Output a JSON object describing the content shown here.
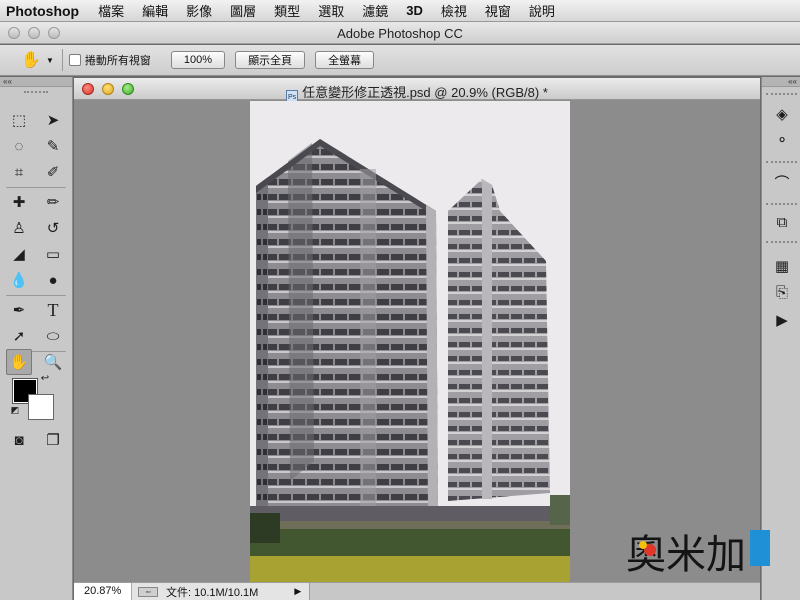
{
  "menu": {
    "app": "Photoshop",
    "items": [
      "檔案",
      "編輯",
      "影像",
      "圖層",
      "類型",
      "選取",
      "濾鏡",
      "3D",
      "檢視",
      "視窗",
      "說明"
    ]
  },
  "window": {
    "title": "Adobe Photoshop CC"
  },
  "options": {
    "scroll_all_label": "捲動所有視窗",
    "zoom_100": "100%",
    "fit_screen": "顯示全頁",
    "fill_screen": "全螢幕"
  },
  "document": {
    "title": "任意變形修正透視.psd @ 20.9% (RGB/8) *",
    "icon_text": "Ps"
  },
  "status": {
    "zoom": "20.87%",
    "doc_size": "文件: 10.1M/10.1M"
  },
  "panels": {
    "collapse_left": "««",
    "collapse_right": "««"
  },
  "watermark": {
    "text": "奧米加"
  },
  "colors": {
    "foreground": "#000000",
    "background": "#ffffff"
  }
}
